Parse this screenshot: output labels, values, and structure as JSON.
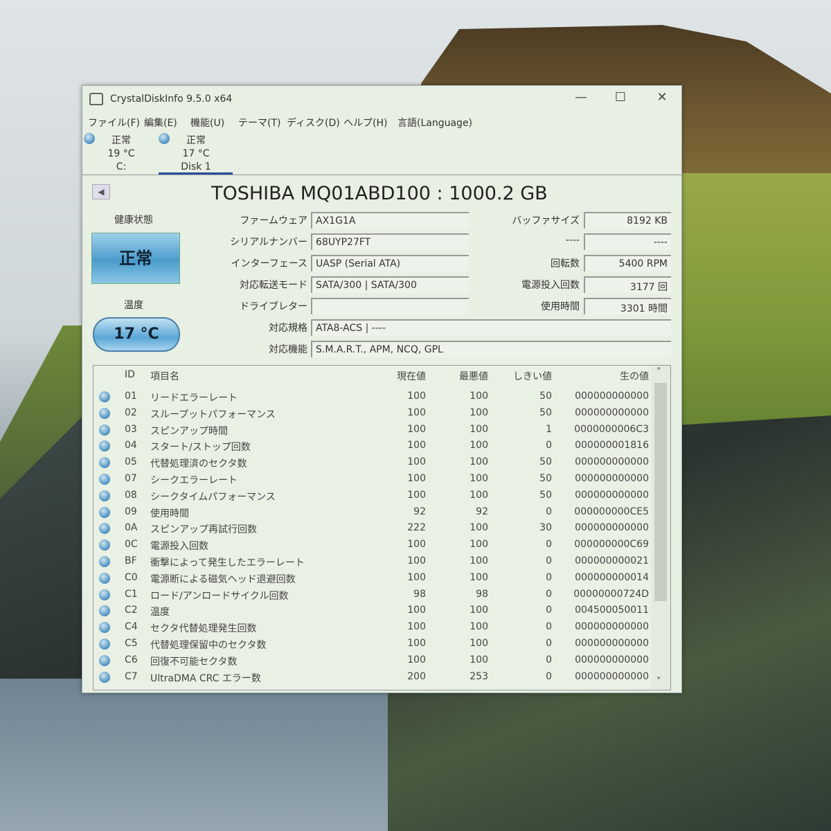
{
  "window": {
    "title": "CrystalDiskInfo 9.5.0 x64",
    "minimize": "—",
    "maximize": "☐",
    "close": "✕"
  },
  "menu": [
    "ファイル(F)",
    "編集(E)",
    "機能(U)",
    "テーマ(T)",
    "ディスク(D)",
    "ヘルプ(H)",
    "言語(Language)"
  ],
  "disks": [
    {
      "status": "正常",
      "temp": "19 °C",
      "name": "C:"
    },
    {
      "status": "正常",
      "temp": "17 °C",
      "name": "Disk 1"
    }
  ],
  "nav_prev": "◀",
  "model": "TOSHIBA MQ01ABD100 : 1000.2 GB",
  "health": {
    "label": "健康状態",
    "value": "正常"
  },
  "temperature": {
    "label": "温度",
    "value": "17 °C"
  },
  "info_left": [
    {
      "label": "ファームウェア",
      "value": "AX1G1A"
    },
    {
      "label": "シリアルナンバー",
      "value": "68UYP27FT"
    },
    {
      "label": "インターフェース",
      "value": "UASP (Serial ATA)"
    },
    {
      "label": "対応転送モード",
      "value": "SATA/300 | SATA/300"
    },
    {
      "label": "ドライブレター",
      "value": ""
    }
  ],
  "info_right": [
    {
      "label": "バッファサイズ",
      "value": "8192 KB"
    },
    {
      "label": "----",
      "value": "----"
    },
    {
      "label": "回転数",
      "value": "5400 RPM"
    },
    {
      "label": "電源投入回数",
      "value": "3177 回"
    },
    {
      "label": "使用時間",
      "value": "3301 時間"
    }
  ],
  "info_wide": [
    {
      "label": "対応規格",
      "value": "ATA8-ACS | ----"
    },
    {
      "label": "対応機能",
      "value": "S.M.A.R.T., APM, NCQ, GPL"
    }
  ],
  "smart": {
    "headers": [
      "ID",
      "項目名",
      "現在値",
      "最悪値",
      "しきい値",
      "生の値"
    ],
    "rows": [
      [
        "01",
        "リードエラーレート",
        "100",
        "100",
        "50",
        "000000000000"
      ],
      [
        "02",
        "スループットパフォーマンス",
        "100",
        "100",
        "50",
        "000000000000"
      ],
      [
        "03",
        "スピンアップ時間",
        "100",
        "100",
        "1",
        "0000000006C3"
      ],
      [
        "04",
        "スタート/ストップ回数",
        "100",
        "100",
        "0",
        "000000001816"
      ],
      [
        "05",
        "代替処理済のセクタ数",
        "100",
        "100",
        "50",
        "000000000000"
      ],
      [
        "07",
        "シークエラーレート",
        "100",
        "100",
        "50",
        "000000000000"
      ],
      [
        "08",
        "シークタイムパフォーマンス",
        "100",
        "100",
        "50",
        "000000000000"
      ],
      [
        "09",
        "使用時間",
        "92",
        "92",
        "0",
        "000000000CE5"
      ],
      [
        "0A",
        "スピンアップ再試行回数",
        "222",
        "100",
        "30",
        "000000000000"
      ],
      [
        "0C",
        "電源投入回数",
        "100",
        "100",
        "0",
        "000000000C69"
      ],
      [
        "BF",
        "衝撃によって発生したエラーレート",
        "100",
        "100",
        "0",
        "000000000021"
      ],
      [
        "C0",
        "電源断による磁気ヘッド退避回数",
        "100",
        "100",
        "0",
        "000000000014"
      ],
      [
        "C1",
        "ロード/アンロードサイクル回数",
        "98",
        "98",
        "0",
        "00000000724D"
      ],
      [
        "C2",
        "温度",
        "100",
        "100",
        "0",
        "004500050011"
      ],
      [
        "C4",
        "セクタ代替処理発生回数",
        "100",
        "100",
        "0",
        "000000000000"
      ],
      [
        "C5",
        "代替処理保留中のセクタ数",
        "100",
        "100",
        "0",
        "000000000000"
      ],
      [
        "C6",
        "回復不可能セクタ数",
        "100",
        "100",
        "0",
        "000000000000"
      ],
      [
        "C7",
        "UltraDMA CRC エラー数",
        "200",
        "253",
        "0",
        "000000000000"
      ]
    ],
    "scroll_up": "˄",
    "scroll_down": "˅"
  }
}
